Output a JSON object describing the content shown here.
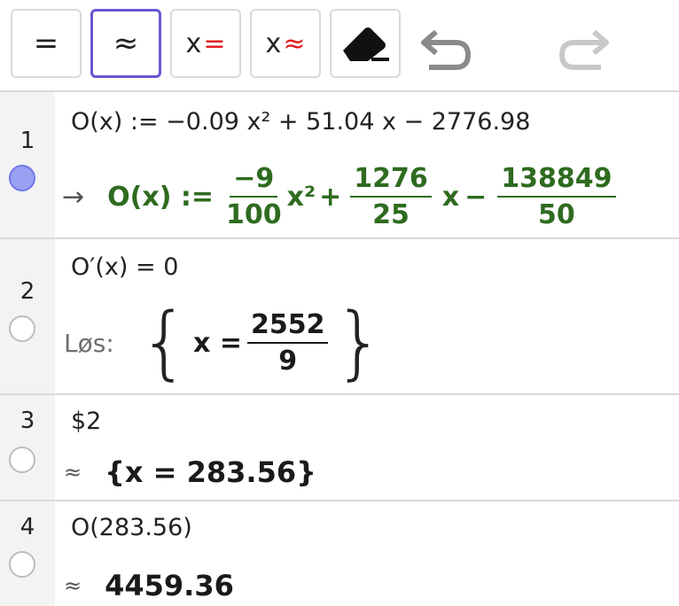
{
  "toolbar": {
    "exact_label": "=",
    "numeric_label": "≈",
    "keep_input_x": "x",
    "keep_input_sym": "=",
    "approx_input_x": "x",
    "approx_input_sym": "≈"
  },
  "rows": [
    {
      "number": "1",
      "input": "O(x) := −0.09 x² + 51.04 x − 2776.98",
      "output": {
        "arrow": "→",
        "lhs": "O(x) :=",
        "a_num": "−9",
        "a_den": "100",
        "x2": "x²",
        "plus": "+",
        "b_num": "1276",
        "b_den": "25",
        "x": "x",
        "minus": "−",
        "c_num": "138849",
        "c_den": "50"
      }
    },
    {
      "number": "2",
      "input": "O′(x) = 0",
      "output": {
        "prefix": "Løs:",
        "var": "x =",
        "num": "2552",
        "den": "9"
      }
    },
    {
      "number": "3",
      "input": "$2",
      "output": {
        "approx": "≈",
        "value": "{x = 283.56}"
      }
    },
    {
      "number": "4",
      "input": "O(283.56)",
      "output": {
        "approx": "≈",
        "value": "4459.36"
      }
    }
  ]
}
